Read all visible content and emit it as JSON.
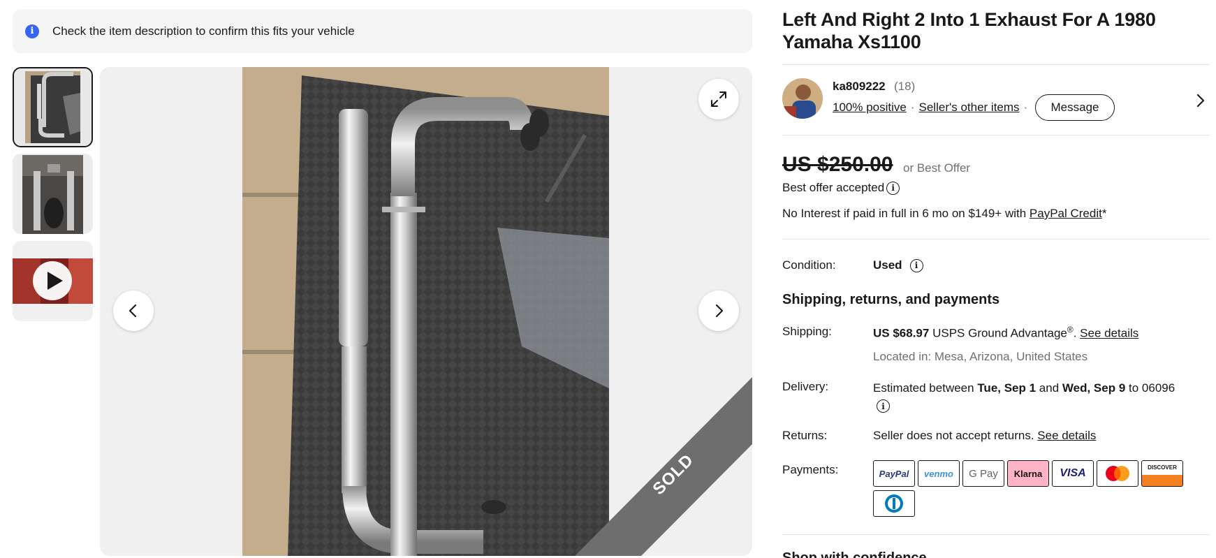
{
  "notice": {
    "text": "Check the item description to confirm this fits your vehicle",
    "icon": "info-icon"
  },
  "gallery": {
    "sold_label": "SOLD",
    "thumbnail_count": 3,
    "video_thumbnail_icon": "play-icon"
  },
  "listing": {
    "title": "Left And Right 2 Into 1 Exhaust For A 1980 Yamaha Xs1100"
  },
  "seller": {
    "name": "ka809222",
    "feedback_count": "(18)",
    "positive": "100% positive",
    "other_items": "Seller's other items",
    "message_button": "Message"
  },
  "price": {
    "amount": "US $250.00",
    "best_offer": "or Best Offer",
    "offer_status": "Best offer accepted",
    "financing_prefix": "No Interest if paid in full in 6 mo on $149+ with ",
    "financing_link": "PayPal Credit",
    "financing_suffix": "*"
  },
  "condition": {
    "label": "Condition:",
    "value": "Used"
  },
  "shipping_section": {
    "heading": "Shipping, returns, and payments",
    "shipping_label": "Shipping:",
    "shipping_price": "US $68.97",
    "shipping_service": "USPS Ground Advantage",
    "shipping_registered": "®",
    "shipping_link": "See details",
    "location": "Located in: Mesa, Arizona, United States",
    "delivery_label": "Delivery:",
    "delivery_prefix": "Estimated between ",
    "delivery_start": "Tue, Sep 1",
    "delivery_and": " and ",
    "delivery_end": "Wed, Sep 9",
    "delivery_suffix": " to 06096",
    "returns_label": "Returns:",
    "returns_text": "Seller does not accept returns. ",
    "returns_link": "See details",
    "payments_label": "Payments:"
  },
  "payment_methods": [
    "PayPal",
    "venmo",
    "G Pay",
    "Klarna",
    "VISA",
    "Mastercard",
    "DISCOVER",
    "Diners Club"
  ],
  "colors": {
    "accent_blue": "#3665f3",
    "text": "#191919",
    "muted": "#707070",
    "klarna_pink": "#ffb3c7"
  },
  "footer": {
    "shop_with_confidence": "Shop with confidence"
  }
}
